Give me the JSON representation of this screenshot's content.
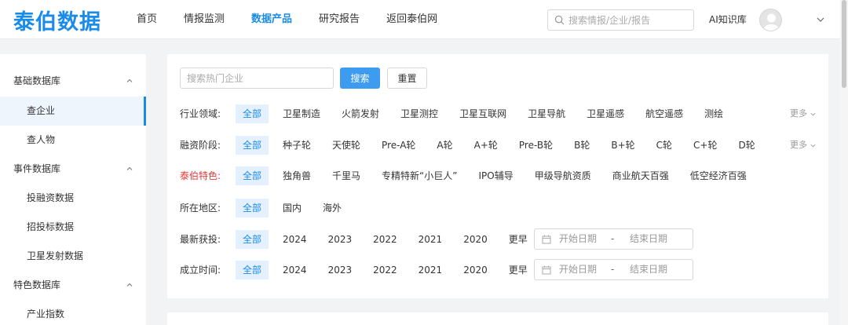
{
  "header": {
    "logo": "泰伯数据",
    "nav": [
      "首页",
      "情报监测",
      "数据产品",
      "研究报告",
      "返回泰伯网"
    ],
    "active_nav": 2,
    "search_placeholder": "搜索情报/企业/报告",
    "ai_library": "AI知识库"
  },
  "sidebar": {
    "groups": [
      {
        "label": "基础数据库",
        "items": [
          "查企业",
          "查人物"
        ]
      },
      {
        "label": "事件数据库",
        "items": [
          "投融资数据",
          "招投标数据",
          "卫星发射数据"
        ]
      },
      {
        "label": "特色数据库",
        "items": [
          "产业指数"
        ]
      }
    ],
    "active_item": "查企业"
  },
  "filter": {
    "search_placeholder": "搜索热门企业",
    "search_button": "搜索",
    "reset_button": "重置",
    "more_label": "更多",
    "rows": [
      {
        "label": "行业领域:",
        "options": [
          "全部",
          "卫星制造",
          "火箭发射",
          "卫星测控",
          "卫星互联网",
          "卫星导航",
          "卫星遥感",
          "航空遥感",
          "测绘"
        ],
        "more": true
      },
      {
        "label": "融资阶段:",
        "options": [
          "全部",
          "种子轮",
          "天使轮",
          "Pre-A轮",
          "A轮",
          "A+轮",
          "Pre-B轮",
          "B轮",
          "B+轮",
          "C轮",
          "C+轮",
          "D轮"
        ],
        "more": true
      },
      {
        "label": "泰伯特色:",
        "options": [
          "全部",
          "独角兽",
          "千里马",
          "专精特新“小巨人”",
          "IPO辅导",
          "甲级导航资质",
          "商业航天百强",
          "低空经济百强"
        ],
        "highlight": true
      },
      {
        "label": "所在地区:",
        "options": [
          "全部",
          "国内",
          "海外"
        ]
      },
      {
        "label": "最新获投:",
        "options": [
          "全部",
          "2024",
          "2023",
          "2022",
          "2021",
          "2020",
          "更早"
        ],
        "date_range": true
      },
      {
        "label": "成立时间:",
        "options": [
          "全部",
          "2024",
          "2023",
          "2022",
          "2021",
          "2020",
          "更早"
        ],
        "date_range": true
      }
    ],
    "date_start_placeholder": "开始日期",
    "date_end_placeholder": "结束日期",
    "date_separator": "-"
  },
  "colors": {
    "brand": "#1b8be8",
    "highlight_label": "#e33a3a",
    "selected_bg": "#e4f0fd"
  }
}
